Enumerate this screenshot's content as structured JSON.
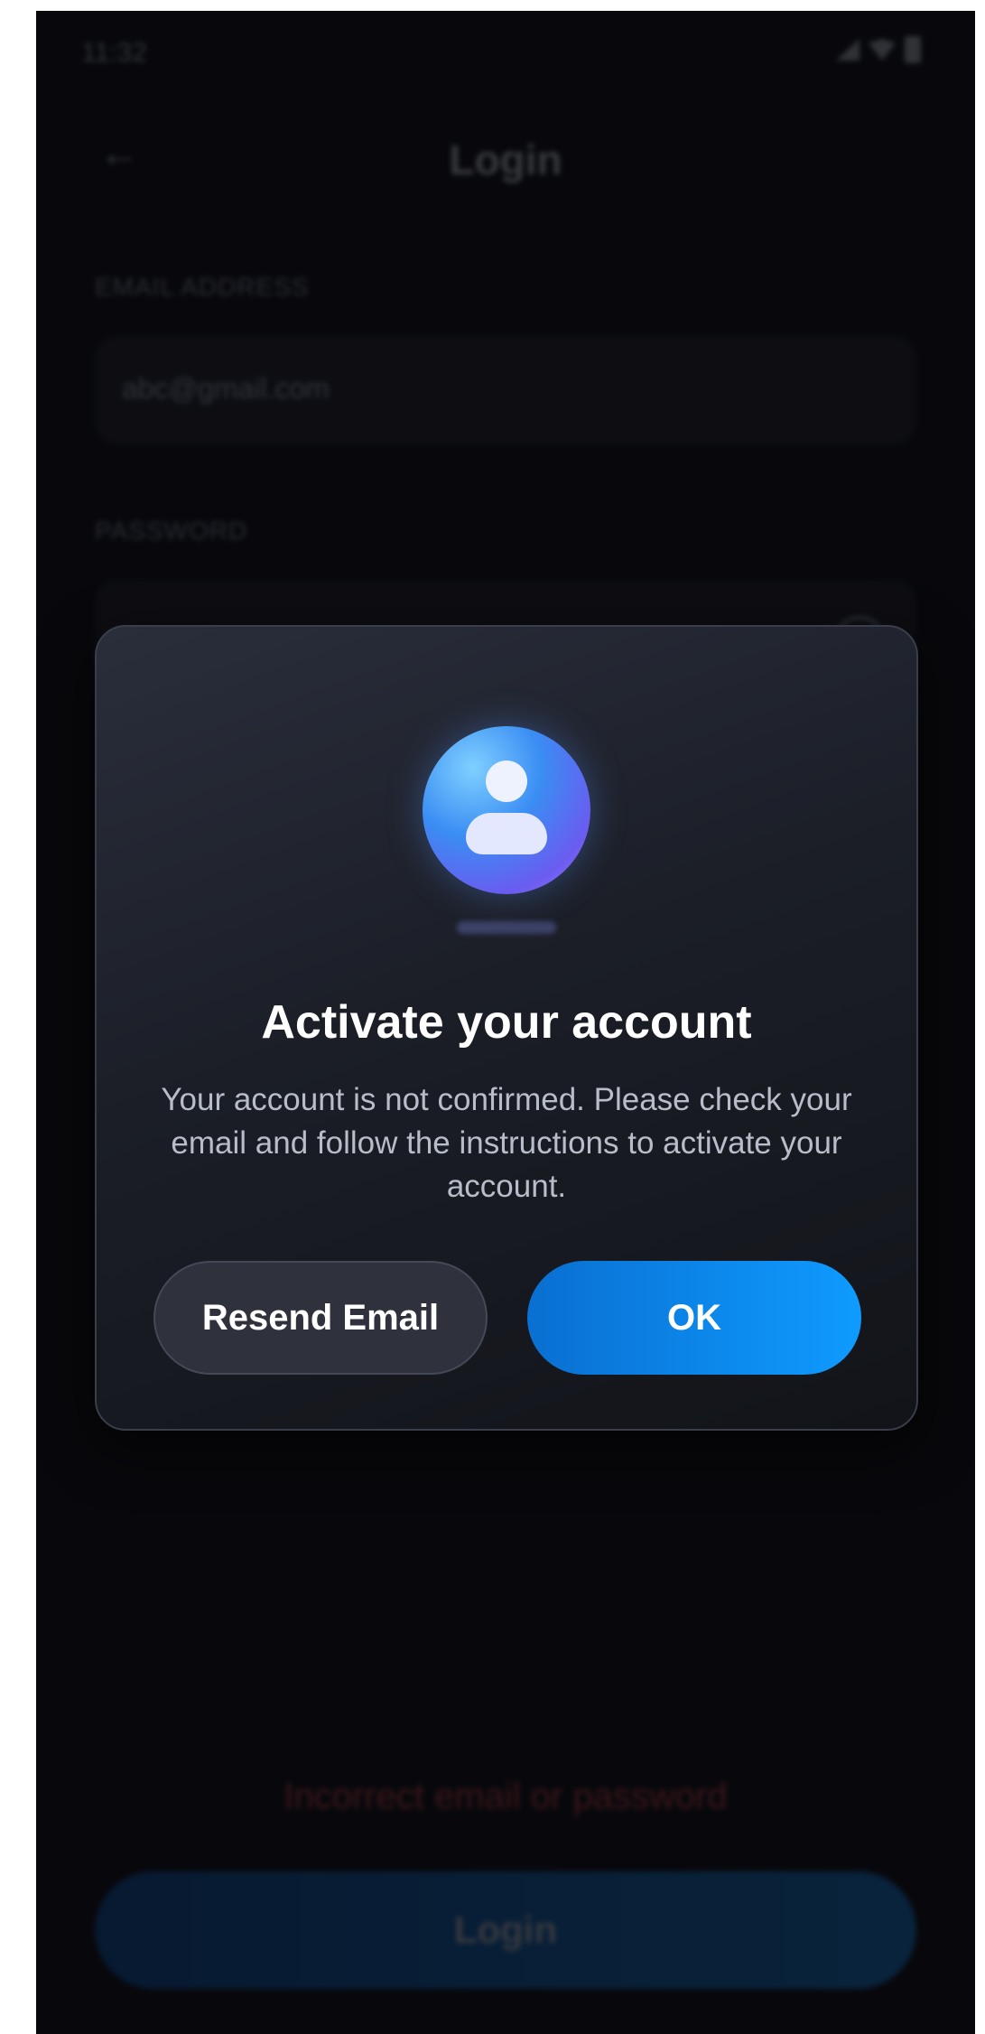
{
  "status_bar": {
    "time": "11:32"
  },
  "app_bar": {
    "title": "Login",
    "back_icon": "arrow-left-icon"
  },
  "form": {
    "email_label": "EMAIL ADDRESS",
    "email_value": "abc@gmail.com",
    "password_label": "PASSWORD",
    "password_visibility_icon": "eye-icon"
  },
  "error": {
    "message": "Incorrect email or password"
  },
  "login_button": {
    "label": "Login"
  },
  "dialog": {
    "icon": "user-avatar-icon",
    "title": "Activate your account",
    "message": "Your account is not confirmed. Please check your email and follow the instructions to activate your account.",
    "secondary_button": "Resend Email",
    "primary_button": "OK"
  },
  "colors": {
    "background": "#0b0c10",
    "dialog_top": "#2a2e3b",
    "primary_button": "#0f9bff",
    "secondary_button": "#2f323d",
    "error": "#ff4d4d"
  }
}
